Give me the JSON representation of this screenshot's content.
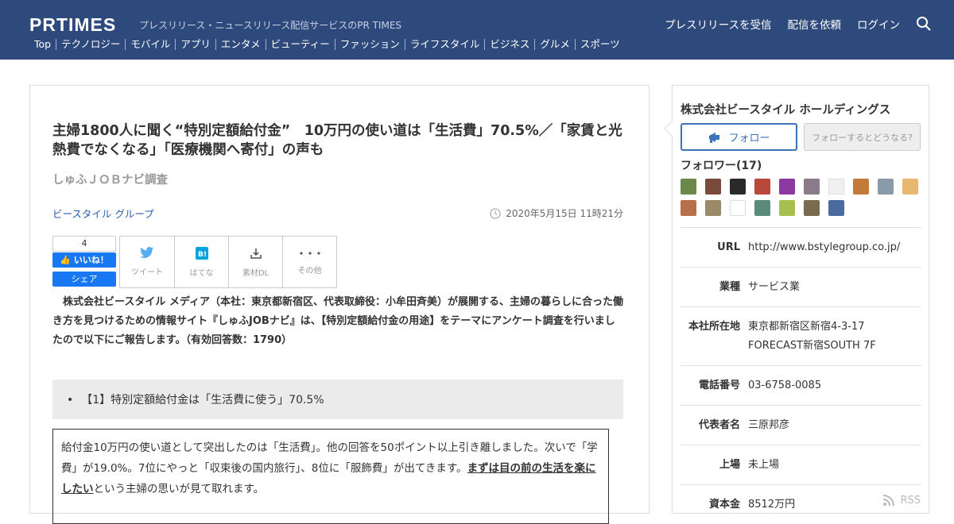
{
  "header": {
    "logo": "PRTIMES",
    "tagline": "プレスリリース・ニュースリリース配信サービスのPR TIMES",
    "nav": [
      "プレスリリースを受信",
      "配信を依頼",
      "ログイン"
    ],
    "categories": [
      "Top",
      "テクノロジー",
      "モバイル",
      "アプリ",
      "エンタメ",
      "ビューティー",
      "ファッション",
      "ライフスタイル",
      "ビジネス",
      "グルメ",
      "スポーツ"
    ]
  },
  "article": {
    "title": "主婦1800人に聞く“特別定額給付金”　10万円の使い道は「生活費」70.5%／「家賃と光熱費でなくなる」「医療機関へ寄付」の声も",
    "subtitle": "しゅふＪＯＢナビ調査",
    "company": "ビースタイル グループ",
    "date": "2020年5月15日 11時21分",
    "like_count": "4",
    "like_label": "いいね！",
    "share_label": "シェア",
    "share_buttons": [
      {
        "label": "ツイート",
        "icon": "twitter-icon"
      },
      {
        "label": "はてな",
        "icon": "hatena-icon"
      },
      {
        "label": "素材DL",
        "icon": "download-icon"
      },
      {
        "label": "その他",
        "icon": "more-icon"
      }
    ],
    "lead": "　株式会社ビースタイル メディア（本社：東京都新宿区、代表取締役：小牟田斉美）が展開する、主婦の暮らしに合った働き方を見つけるための情報サイト『しゅふJOBナビ』は、【特別定額給付金の用途】をテーマにアンケート調査を行いましたので以下にご報告します。（有効回答数：1790）",
    "bullet": "【1】特別定額給付金は「生活費に使う」70.5%",
    "quote_part1": "給付金10万円の使い道として突出したのは「生活費」。他の回答を50ポイント以上引き離しました。次いで「学費」が19.0%。7位にやっと「収束後の国内旅行」、8位に「服飾費」が出てきます。",
    "quote_emph": "まずは目の前の生活を楽にしたい",
    "quote_part2": "という主婦の思いが見て取れます。"
  },
  "sidebar": {
    "company_name": "株式会社ビースタイル ホールディングス",
    "follow_label": "フォロー",
    "follow_what_label": "フォローするとどうなる?",
    "followers_title": "フォロワー(17)",
    "avatar_colors": [
      "#6b8a4a",
      "#7a4a3a",
      "#2a2a2a",
      "#b8483a",
      "#8a3aa0",
      "#8a7a8a",
      "#f0f0f0",
      "#c47a3a",
      "#8a9aa8",
      "#e8b870",
      "#b8704a",
      "#9a8a6a",
      "#ffffff",
      "#5a8a7a",
      "#a8c050",
      "#7a6a50",
      "#4a6aa0"
    ],
    "info": [
      {
        "k": "URL",
        "v": "http://www.bstylegroup.co.jp/"
      },
      {
        "k": "業種",
        "v": "サービス業"
      },
      {
        "k": "本社所在地",
        "v": "東京都新宿区新宿4-3-17 FORECAST新宿SOUTH 7F"
      },
      {
        "k": "電話番号",
        "v": "03-6758-0085"
      },
      {
        "k": "代表者名",
        "v": "三原邦彦"
      },
      {
        "k": "上場",
        "v": "未上場"
      },
      {
        "k": "資本金",
        "v": "8512万円"
      }
    ],
    "rss_label": "RSS"
  }
}
